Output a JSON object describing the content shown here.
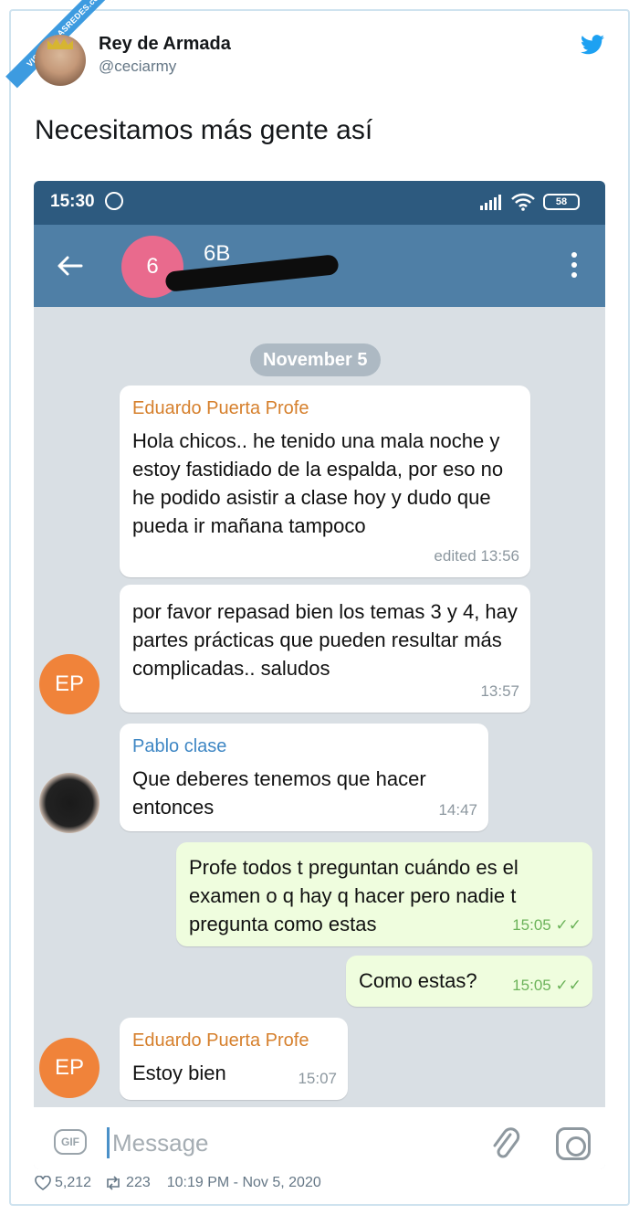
{
  "watermark": "VISTOENLASREDES.com",
  "tweet": {
    "author_name": "Rey de Armada",
    "author_handle": "@ceciarmy",
    "text": "Necesitamos más gente así",
    "likes": "5,212",
    "retweets": "223",
    "timestamp": "10:19 PM - Nov 5, 2020"
  },
  "phone": {
    "status": {
      "time": "15:30",
      "battery": "58"
    },
    "header": {
      "group_initial": "6",
      "group_name": "6B"
    },
    "date_divider": "November 5",
    "messages": [
      {
        "sender": "Eduardo Puerta Profe",
        "text": "Hola chicos.. he tenido una mala noche y estoy fastidiado de la espalda, por eso no he podido asistir a clase hoy y dudo que pueda ir mañana tampoco",
        "meta": "edited 13:56"
      },
      {
        "text": "por favor repasad bien los temas 3 y 4, hay partes prácticas que pueden resultar más complicadas.. saludos",
        "meta": "13:57",
        "avatar": "EP"
      },
      {
        "sender": "Pablo clase",
        "text": "Que deberes tenemos que hacer entonces",
        "meta": "14:47"
      },
      {
        "text": "Profe todos t preguntan cuándo es el examen o q hay q hacer pero nadie t pregunta como estas",
        "meta": "15:05"
      },
      {
        "text": "Como estas?",
        "meta": "15:05"
      },
      {
        "sender": "Eduardo Puerta Profe",
        "text": "Estoy bien",
        "meta": "15:07",
        "avatar": "EP"
      }
    ],
    "input": {
      "placeholder": "Message",
      "gif_label": "GIF"
    }
  },
  "colors": {
    "twitter_blue": "#1da1f2",
    "statusbar": "#2d5a7f",
    "appbar": "#4f7fa6",
    "group_avatar": "#e96a8d",
    "sender_profe": "#d6802d",
    "sender_pablo": "#3f87c4",
    "outgoing_bubble": "#effdde",
    "ep_avatar": "#f0833a"
  }
}
